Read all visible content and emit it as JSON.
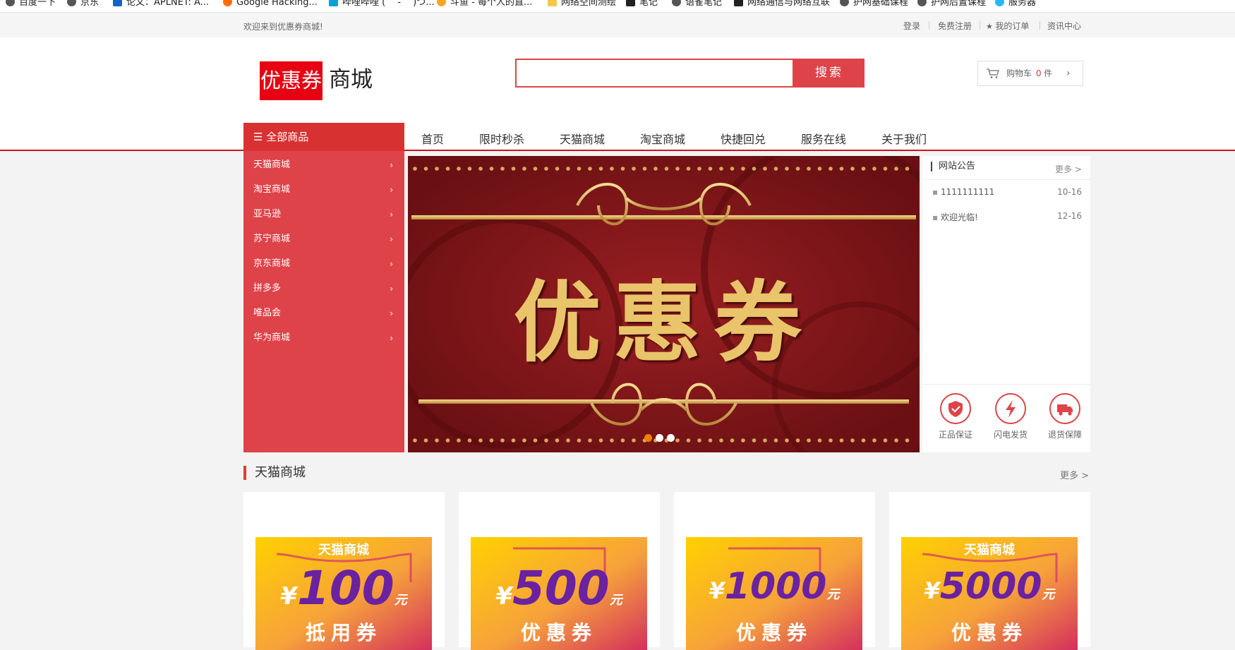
{
  "bookmarks": [
    "百度一下",
    "京东",
    "论文：APLNET: A...",
    "Google Hacking...",
    "哔哩哔哩 ( ゜- ゜)つ...",
    "斗鱼 - 每个人的直...",
    "网络空间测绘",
    "笔记",
    "语雀笔记",
    "网络通信与网络互联",
    "护网基础课程",
    "护网后置课程",
    "服务器"
  ],
  "topbar": {
    "welcome": "欢迎来到优惠券商城!",
    "login": "登录",
    "register": "免费注册",
    "orders": "我的订单",
    "news": "资讯中心"
  },
  "header": {
    "logo_box": "优惠券",
    "logo_text": "商城",
    "search_placeholder": "",
    "search_button": "搜索",
    "cart_label": "购物车",
    "cart_count": "0",
    "cart_unit": "件"
  },
  "nav": {
    "all_goods": "全部商品",
    "items": [
      "首页",
      "限时秒杀",
      "天猫商城",
      "淘宝商城",
      "快捷回兑",
      "服务在线",
      "关于我们"
    ]
  },
  "categories": [
    "天猫商城",
    "淘宝商城",
    "亚马逊",
    "苏宁商城",
    "京东商城",
    "拼多多",
    "唯品会",
    "华为商城"
  ],
  "banner": {
    "text": "优惠券",
    "active_dot": 0,
    "dots": 3
  },
  "notice": {
    "title": "网站公告",
    "more": "更多 >",
    "items": [
      {
        "text": "1111111111",
        "date": "10-16"
      },
      {
        "text": "欢迎光临!",
        "date": "12-16"
      }
    ],
    "services": [
      "正品保证",
      "闪电发货",
      "退货保障"
    ]
  },
  "section": {
    "title": "天猫商城",
    "more": "更多 >",
    "cards": [
      {
        "brand": "天猫商城",
        "amount": "100",
        "unit": "元",
        "label": "抵用券"
      },
      {
        "brand": "",
        "amount": "500",
        "unit": "元",
        "label": "优惠券"
      },
      {
        "brand": "",
        "amount": "1000",
        "unit": "元",
        "label": "优惠券"
      },
      {
        "brand": "天猫商城",
        "amount": "5000",
        "unit": "元",
        "label": "优惠券"
      }
    ]
  },
  "colors": {
    "accent": "#de4349",
    "nav_line": "#c8161d",
    "banner_bg": "#7e1518",
    "gold": "#e9c46a"
  }
}
